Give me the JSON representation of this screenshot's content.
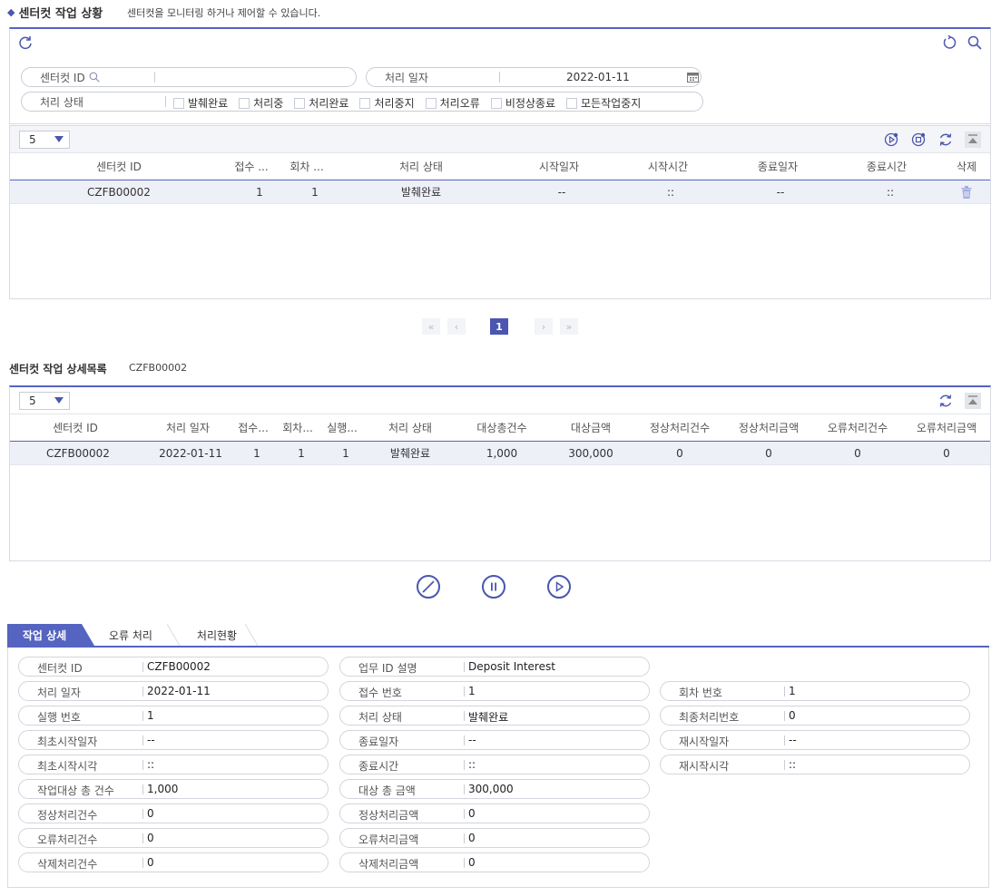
{
  "header": {
    "title": "센터컷 작업 상황",
    "subtitle": "센터컷을 모니터링 하거나 제어할 수 있습니다."
  },
  "filters": {
    "centercut_id_label": "센터컷 ID",
    "date_label": "처리 일자",
    "date_value": "2022-01-11",
    "status_label": "처리 상태",
    "status_options": [
      "발췌완료",
      "처리중",
      "처리완료",
      "처리중지",
      "처리오류",
      "비정상종료",
      "모든작업중지"
    ]
  },
  "grid1": {
    "page_size": "5",
    "headers": [
      "센터컷 ID",
      "접수 ...",
      "회차 ...",
      "처리 상태",
      "시작일자",
      "시작시간",
      "종료일자",
      "종료시간",
      "삭제"
    ],
    "rows": [
      [
        "CZFB00002",
        "1",
        "1",
        "발췌완료",
        "--",
        "::",
        "--",
        "::"
      ]
    ]
  },
  "pagination": {
    "current": "1",
    "first": "«",
    "prev": "‹",
    "next": "›",
    "last": "»"
  },
  "detail_list": {
    "title": "센터컷 작업 상세목록",
    "selected_id": "CZFB00002"
  },
  "grid2": {
    "page_size": "5",
    "headers": [
      "센터컷 ID",
      "처리 일자",
      "접수...",
      "회차...",
      "실행...",
      "처리 상태",
      "대상총건수",
      "대상금액",
      "정상처리건수",
      "정상처리금액",
      "오류처리건수",
      "오류처리금액"
    ],
    "rows": [
      [
        "CZFB00002",
        "2022-01-11",
        "1",
        "1",
        "1",
        "발췌완료",
        "1,000",
        "300,000",
        "0",
        "0",
        "0",
        "0"
      ]
    ]
  },
  "tabs": [
    "작업 상세",
    "오류 처리",
    "처리현황"
  ],
  "detail": {
    "col1": [
      {
        "label": "센터컷 ID",
        "value": "CZFB00002"
      },
      {
        "label": "처리 일자",
        "value": "2022-01-11"
      },
      {
        "label": "실행 번호",
        "value": "1"
      },
      {
        "label": "최초시작일자",
        "value": "--"
      },
      {
        "label": "최초시작시각",
        "value": "::"
      },
      {
        "label": "작업대상 총 건수",
        "value": "1,000"
      },
      {
        "label": "정상처리건수",
        "value": "0"
      },
      {
        "label": "오류처리건수",
        "value": "0"
      },
      {
        "label": "삭제처리건수",
        "value": "0"
      }
    ],
    "col2": [
      {
        "label": "업무 ID 설명",
        "value": "Deposit Interest"
      },
      {
        "label": "접수 번호",
        "value": "1"
      },
      {
        "label": "처리 상태",
        "value": "발췌완료"
      },
      {
        "label": "종료일자",
        "value": "--"
      },
      {
        "label": "종료시간",
        "value": "::"
      },
      {
        "label": "대상 총 금액",
        "value": "300,000"
      },
      {
        "label": "정상처리금액",
        "value": "0"
      },
      {
        "label": "오류처리금액",
        "value": "0"
      },
      {
        "label": "삭제처리금액",
        "value": "0"
      }
    ],
    "col3": [
      {
        "label": "회차 번호",
        "value": "1"
      },
      {
        "label": "최종처리번호",
        "value": "0"
      },
      {
        "label": "재시작일자",
        "value": "--"
      },
      {
        "label": "재시작시각",
        "value": "::"
      }
    ]
  },
  "colors": {
    "accent": "#4a56b0",
    "border": "#5563c1",
    "row_selected": "#eef0f8"
  }
}
